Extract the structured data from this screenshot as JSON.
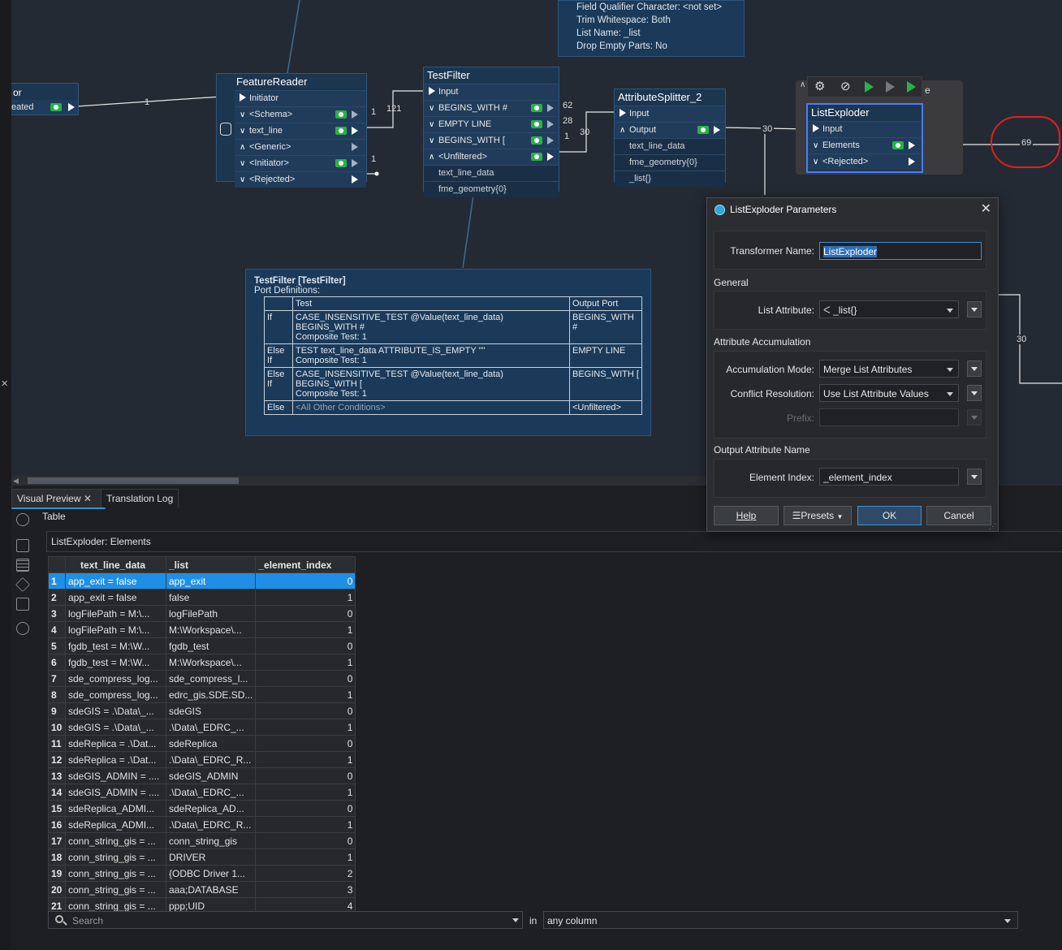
{
  "canvas": {
    "partial_node": {
      "label_top": "or",
      "label_port": "eated",
      "count": "1"
    },
    "feature_reader": {
      "title": "FeatureReader",
      "ports": [
        "Initiator",
        "<Schema>",
        "text_line",
        "<Generic>",
        "<Initiator>",
        "<Rejected>"
      ],
      "counts": {
        "schema": "1",
        "text_line": "121",
        "initiator_out": "1"
      }
    },
    "test_filter": {
      "title": "TestFilter",
      "input": "Input",
      "ports": [
        "BEGINS_WITH #",
        "EMPTY LINE",
        "BEGINS_WITH [",
        "<Unfiltered>"
      ],
      "attrs": [
        "text_line_data",
        "fme_geometry{0}"
      ],
      "counts": [
        "62",
        "28",
        "1"
      ]
    },
    "attribute_splitter": {
      "title": "AttributeSplitter_2",
      "input": "Input",
      "output": "Output",
      "attrs": [
        "text_line_data",
        "fme_geometry{0}",
        "_list{}"
      ],
      "count_in": "30",
      "count_out": "30"
    },
    "list_exploder": {
      "title": "ListExploder",
      "input": "Input",
      "ports": [
        "Elements",
        "<Rejected>"
      ],
      "count_elements": "69",
      "count_side": "30",
      "partial_title_char": "e"
    },
    "info_box": {
      "lines": [
        "Field Qualifier Character: <not set>",
        "Trim Whitespace: Both",
        "List Name: _list",
        "Drop Empty Parts: No"
      ]
    },
    "tooltip": {
      "title": "TestFilter [TestFilter]",
      "subtitle": "Port Definitions:",
      "headers": [
        "",
        "Test",
        "Output Port"
      ],
      "rows": [
        {
          "cond": "If",
          "test": "CASE_INSENSITIVE_TEST @Value(text_line_data) BEGINS_WITH #",
          "composite": "Composite Test: 1",
          "port": "BEGINS_WITH #"
        },
        {
          "cond": "Else If",
          "test": "TEST text_line_data ATTRIBUTE_IS_EMPTY \"\"",
          "composite": "Composite Test: 1",
          "port": "EMPTY LINE"
        },
        {
          "cond": "Else If",
          "test": "CASE_INSENSITIVE_TEST @Value(text_line_data) BEGINS_WITH [",
          "composite": "Composite Test: 1",
          "port": "BEGINS_WITH ["
        },
        {
          "cond": "Else",
          "test": "<All Other Conditions>",
          "composite": "",
          "port": "<Unfiltered>"
        }
      ]
    }
  },
  "dialog": {
    "title": "ListExploder Parameters",
    "transformer_name_label": "Transformer Name:",
    "transformer_name": "ListExploder",
    "general_label": "General",
    "list_attribute_label": "List Attribute:",
    "list_attribute": "_list{}",
    "accumulation_label": "Attribute Accumulation",
    "accumulation_mode_label": "Accumulation Mode:",
    "accumulation_mode": "Merge List Attributes",
    "conflict_label": "Conflict Resolution:",
    "conflict": "Use List Attribute Values",
    "prefix_label": "Prefix:",
    "output_name_label": "Output Attribute Name",
    "element_index_label": "Element Index:",
    "element_index": "_element_index",
    "buttons": {
      "help": "Help",
      "presets": "Presets",
      "ok": "OK",
      "cancel": "Cancel"
    }
  },
  "panel": {
    "tabs": [
      "Visual Preview",
      "Translation Log"
    ],
    "view_label": "Table",
    "table_title": "ListExploder: Elements",
    "columns": [
      "text_line_data",
      "_list",
      "_element_index"
    ],
    "rows": [
      [
        "1",
        "app_exit = false",
        "app_exit",
        "0"
      ],
      [
        "2",
        "app_exit = false",
        "false",
        "1"
      ],
      [
        "3",
        "logFilePath = M:\\...",
        "logFilePath",
        "0"
      ],
      [
        "4",
        "logFilePath = M:\\...",
        "M:\\Workspace\\...",
        "1"
      ],
      [
        "5",
        "fgdb_test = M:\\W...",
        "fgdb_test",
        "0"
      ],
      [
        "6",
        "fgdb_test = M:\\W...",
        "M:\\Workspace\\...",
        "1"
      ],
      [
        "7",
        "sde_compress_log...",
        "sde_compress_l...",
        "0"
      ],
      [
        "8",
        "sde_compress_log...",
        "edrc_gis.SDE.SD...",
        "1"
      ],
      [
        "9",
        "sdeGIS = .\\Data\\_...",
        "sdeGIS",
        "0"
      ],
      [
        "10",
        "sdeGIS = .\\Data\\_...",
        ".\\Data\\_EDRC_...",
        "1"
      ],
      [
        "11",
        "sdeReplica = .\\Dat...",
        "sdeReplica",
        "0"
      ],
      [
        "12",
        "sdeReplica = .\\Dat...",
        ".\\Data\\_EDRC_R...",
        "1"
      ],
      [
        "13",
        "sdeGIS_ADMIN = ....",
        "sdeGIS_ADMIN",
        "0"
      ],
      [
        "14",
        "sdeGIS_ADMIN = ....",
        ".\\Data\\_EDRC_...",
        "1"
      ],
      [
        "15",
        "sdeReplica_ADMI...",
        "sdeReplica_AD...",
        "0"
      ],
      [
        "16",
        "sdeReplica_ADMI...",
        ".\\Data\\_EDRC_R...",
        "1"
      ],
      [
        "17",
        "conn_string_gis = ...",
        "conn_string_gis",
        "0"
      ],
      [
        "18",
        "conn_string_gis = ...",
        "DRIVER",
        "1"
      ],
      [
        "19",
        "conn_string_gis = ...",
        "{ODBC Driver 1...",
        "2"
      ],
      [
        "20",
        "conn_string_gis = ...",
        "aaa;DATABASE",
        "3"
      ],
      [
        "21",
        "conn_string_gis = ...",
        "ppp;UID",
        "4"
      ]
    ],
    "search_placeholder": "Search",
    "in_label": "in",
    "scope": "any column"
  }
}
